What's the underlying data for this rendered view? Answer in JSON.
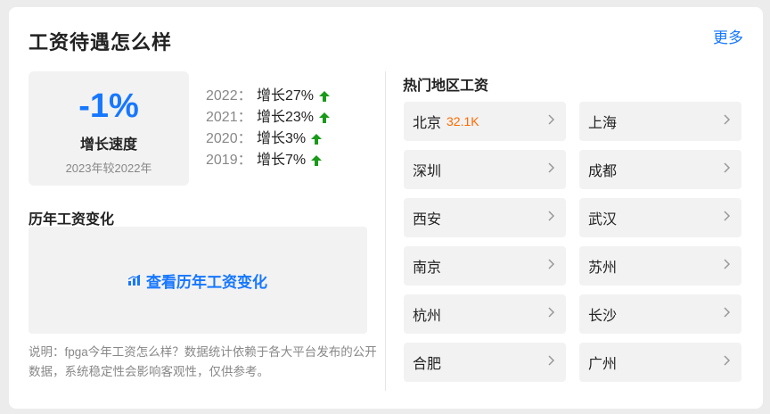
{
  "header": {
    "title": "工资待遇怎么样",
    "more_label": "更多"
  },
  "growth": {
    "value": "-1%",
    "label": "增长速度",
    "compare": "2023年较2022年"
  },
  "yearly": [
    {
      "year": "2022：",
      "text": "增长27%",
      "trend": "up"
    },
    {
      "year": "2021：",
      "text": "增长23%",
      "trend": "up"
    },
    {
      "year": "2020：",
      "text": "增长3%",
      "trend": "up"
    },
    {
      "year": "2019：",
      "text": "增长7%",
      "trend": "up"
    }
  ],
  "history": {
    "section_title": "历年工资变化",
    "link_label": "查看历年工资变化"
  },
  "note": "说明：fpga今年工资怎么样？数据统计依赖于各大平台发布的公开数据，系统稳定性会影响客观性，仅供参考。",
  "regions": {
    "title": "热门地区工资",
    "cities": [
      {
        "name": "北京",
        "salary": "32.1K"
      },
      {
        "name": "上海",
        "salary": ""
      },
      {
        "name": "深圳",
        "salary": ""
      },
      {
        "name": "成都",
        "salary": ""
      },
      {
        "name": "西安",
        "salary": ""
      },
      {
        "name": "武汉",
        "salary": ""
      },
      {
        "name": "南京",
        "salary": ""
      },
      {
        "name": "苏州",
        "salary": ""
      },
      {
        "name": "杭州",
        "salary": ""
      },
      {
        "name": "长沙",
        "salary": ""
      },
      {
        "name": "合肥",
        "salary": ""
      },
      {
        "name": "广州",
        "salary": ""
      }
    ]
  },
  "colors": {
    "accent": "#1677ff",
    "up_arrow": "#1a9a1a",
    "salary": "#ff6a00"
  }
}
